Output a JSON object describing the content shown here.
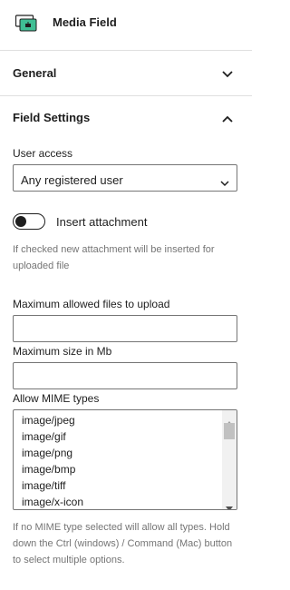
{
  "block": {
    "title": "Media Field",
    "icon": "media-field-icon",
    "accent": "#3fbf94"
  },
  "panels": {
    "general": {
      "label": "General",
      "expanded": false
    },
    "field_settings": {
      "label": "Field Settings",
      "expanded": true
    }
  },
  "user_access": {
    "label": "User access",
    "selected": "Any registered user"
  },
  "insert_attachment": {
    "label": "Insert attachment",
    "enabled": false,
    "help": "If checked new attachment will be inserted for uploaded file"
  },
  "max_files": {
    "label": "Maximum allowed files to upload",
    "value": ""
  },
  "max_size": {
    "label": "Maximum size in Mb",
    "value": ""
  },
  "mime_types": {
    "label": "Allow MIME types",
    "options": [
      "image/jpeg",
      "image/gif",
      "image/png",
      "image/bmp",
      "image/tiff",
      "image/x-icon"
    ],
    "help": "If no MIME type selected will allow all types. Hold down the Ctrl (windows) / Command (Mac) button to select multiple options."
  }
}
